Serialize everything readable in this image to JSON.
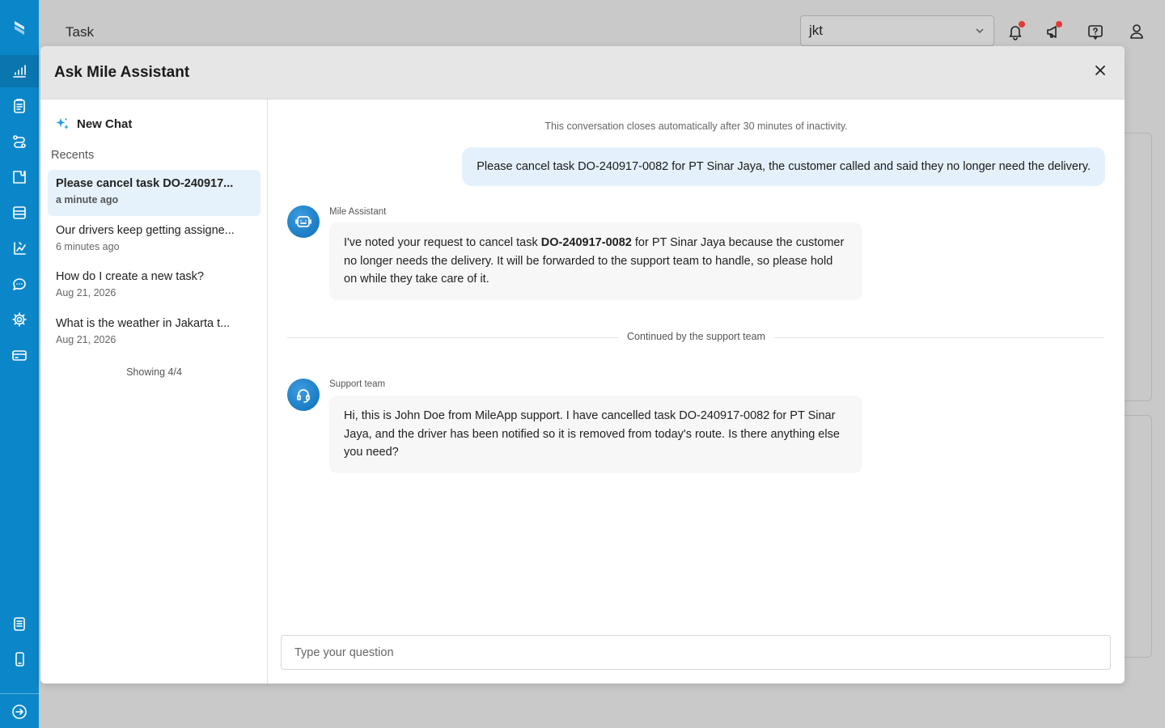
{
  "app": {
    "page_title": "Task",
    "org_selector_value": "jkt"
  },
  "modal": {
    "title": "Ask Mile Assistant"
  },
  "sidebar": {
    "new_chat_label": "New Chat",
    "recents_label": "Recents",
    "recents": [
      {
        "title": "Please cancel task DO-240917...",
        "time": "a minute ago"
      },
      {
        "title": "Our drivers keep getting assigne...",
        "time": "6 minutes ago"
      },
      {
        "title": "How do I create a new task?",
        "time": "Aug 21, 2026"
      },
      {
        "title": "What is the weather in Jakarta t...",
        "time": "Aug 21, 2026"
      }
    ],
    "showing": "Showing 4/4"
  },
  "chat": {
    "notice": "This conversation closes automatically after 30 minutes of inactivity.",
    "user_message": "Please cancel task DO-240917-0082 for PT Sinar Jaya, the customer called and said they no longer need the delivery.",
    "assistant": {
      "sender": "Mile Assistant",
      "text_before": "I've noted your request to cancel task ",
      "text_bold": "DO-240917-0082",
      "text_after": " for PT Sinar Jaya because the customer no longer needs the delivery. It will be forwarded to the support team to handle, so please hold on while they take care of it."
    },
    "divider_label": "Continued by the support team",
    "support": {
      "sender": "Support team",
      "text": "Hi, this is John Doe from MileApp support. I have cancelled task DO-240917-0082 for PT Sinar Jaya, and the driver has been notified so it is removed from today's route. Is there anything else you need?"
    },
    "input_placeholder": "Type your question"
  },
  "colors": {
    "rail": "#0b87c9",
    "accent": "#0b6fb8",
    "user_bubble": "#e4f1fc",
    "notification_dot": "#e53935"
  },
  "icons": {
    "rail": [
      "logo-icon",
      "dashboard-icon",
      "task-icon",
      "routing-icon",
      "integration-icon",
      "database-icon",
      "optimization-icon",
      "chat-icon",
      "settings-icon",
      "billing-icon",
      "document-icon",
      "mobile-icon",
      "exit-icon"
    ],
    "top": [
      "bell-icon",
      "announcement-icon",
      "help-icon",
      "user-icon"
    ]
  }
}
